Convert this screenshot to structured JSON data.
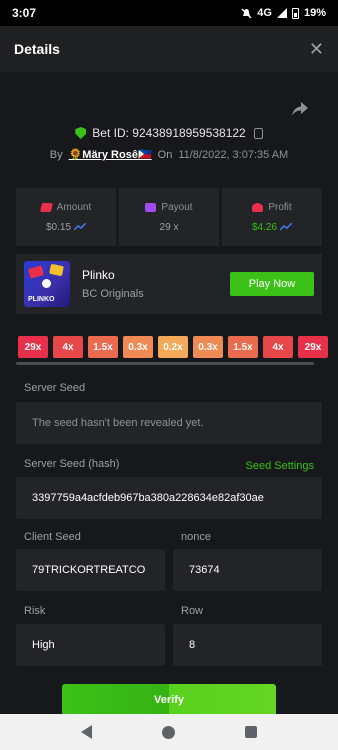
{
  "status_bar": {
    "time": "3:07",
    "network": "4G",
    "battery": "19%"
  },
  "header": {
    "title": "Details",
    "close": "✕"
  },
  "bet": {
    "id_label": "Bet ID: 92438918959538122",
    "by_label": "By",
    "user": "🌻Märy Rosê🇵🇭",
    "on_label": "On",
    "date": "11/8/2022, 3:07:35 AM"
  },
  "stats": {
    "amount": {
      "label": "Amount",
      "value": "$0.15"
    },
    "payout": {
      "label": "Payout",
      "value": "29 x"
    },
    "profit": {
      "label": "Profit",
      "value": "$4.26"
    }
  },
  "game": {
    "name": "Plinko",
    "provider": "BC Originals",
    "thumb_text": "PLINKO",
    "play_label": "Play Now"
  },
  "multipliers": [
    {
      "label": "29x",
      "color": "#e8304a"
    },
    {
      "label": "4x",
      "color": "#e8474a"
    },
    {
      "label": "1.5x",
      "color": "#ec6a4e"
    },
    {
      "label": "0.3x",
      "color": "#f08a55"
    },
    {
      "label": "0.2x",
      "color": "#f3a957"
    },
    {
      "label": "0.3x",
      "color": "#f08a55"
    },
    {
      "label": "1.5x",
      "color": "#ec6a4e"
    },
    {
      "label": "4x",
      "color": "#e8474a"
    },
    {
      "label": "29x",
      "color": "#e8304a"
    }
  ],
  "fields": {
    "server_seed": {
      "label": "Server Seed",
      "value": "The seed hasn't been revealed yet."
    },
    "server_seed_hash": {
      "label": "Server Seed (hash)",
      "value": "3397759a4acfdeb967ba380a228634e82af30ae",
      "settings_label": "Seed Settings"
    },
    "client_seed": {
      "label": "Client Seed",
      "value": "79TRICKORTREATCO"
    },
    "nonce": {
      "label": "nonce",
      "value": "73674"
    },
    "risk": {
      "label": "Risk",
      "value": "High"
    },
    "row": {
      "label": "Row",
      "value": "8"
    }
  },
  "verify_label": "Verify",
  "colors": {
    "accent_green": "#3bc117",
    "panel": "#222427",
    "background": "#17181b"
  }
}
